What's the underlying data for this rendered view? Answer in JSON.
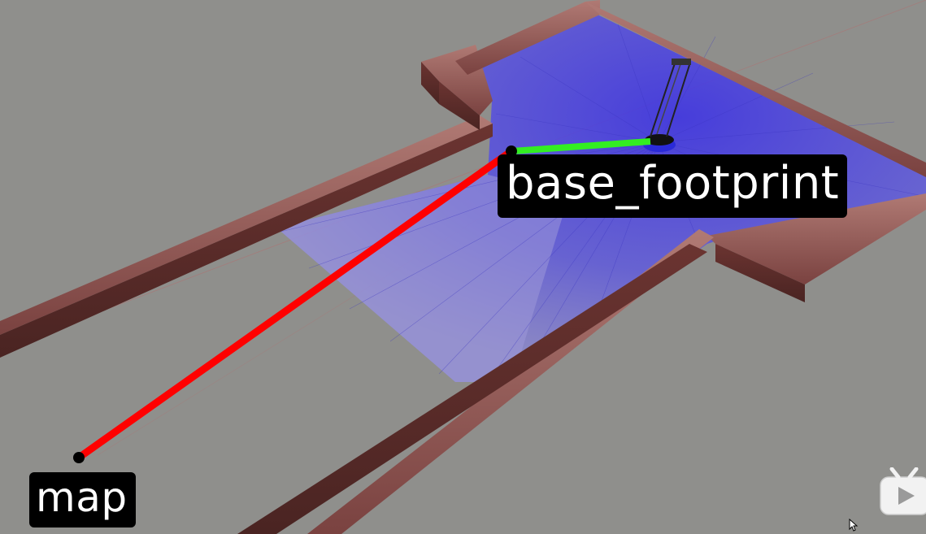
{
  "viewport": {
    "background": "#8f8f8c",
    "frames": [
      {
        "id": "base_footprint",
        "label": "base_footprint",
        "axis_color": "#ff0000"
      },
      {
        "id": "map",
        "label": "map"
      }
    ],
    "colors": {
      "transform_line": "#ff0000",
      "robot_axis": "#33ee22",
      "wall": "#7b3f3c",
      "laser_scan": "#5a52e0",
      "floor": "#8f8f8c"
    }
  },
  "overlay": {
    "player_icon": "video-player-logo-icon",
    "cursor_icon": "mouse-pointer-icon"
  }
}
